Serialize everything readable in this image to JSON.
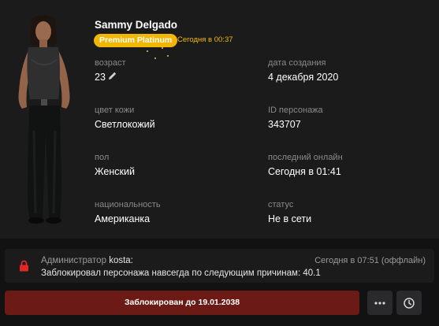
{
  "profile": {
    "name": "Sammy Delgado",
    "badge": "Premium Platinum",
    "badge_time": "Сегодня в 00:37"
  },
  "fields": {
    "age_label": "возраст",
    "age_value": "23",
    "created_label": "дата создания",
    "created_value": "4 декабря 2020",
    "skin_label": "цвет кожи",
    "skin_value": "Светлокожий",
    "id_label": "ID персонажа",
    "id_value": "343707",
    "gender_label": "пол",
    "gender_value": "Женский",
    "online_label": "последний онлайн",
    "online_value": "Сегодня в 01:41",
    "nation_label": "национальность",
    "nation_value": "Американка",
    "status_label": "статус",
    "status_value": "Не в сети"
  },
  "notice": {
    "admin_prefix": "Администратор",
    "admin_name": "kosta:",
    "time": "Сегодня в 07:51 (оффлайн)",
    "text": "Заблокировал персонажа навсегда по следующим причинам: 40.1"
  },
  "actions": {
    "ban_label": "Заблокирован до 19.01.2038",
    "more_icon": "more-horizontal-icon",
    "history_icon": "clock-history-icon"
  },
  "colors": {
    "background": "#121212",
    "card": "#1b1b1b",
    "badge": "#f2b705",
    "ban_button": "#6b1a15",
    "lock": "#e0282a"
  }
}
